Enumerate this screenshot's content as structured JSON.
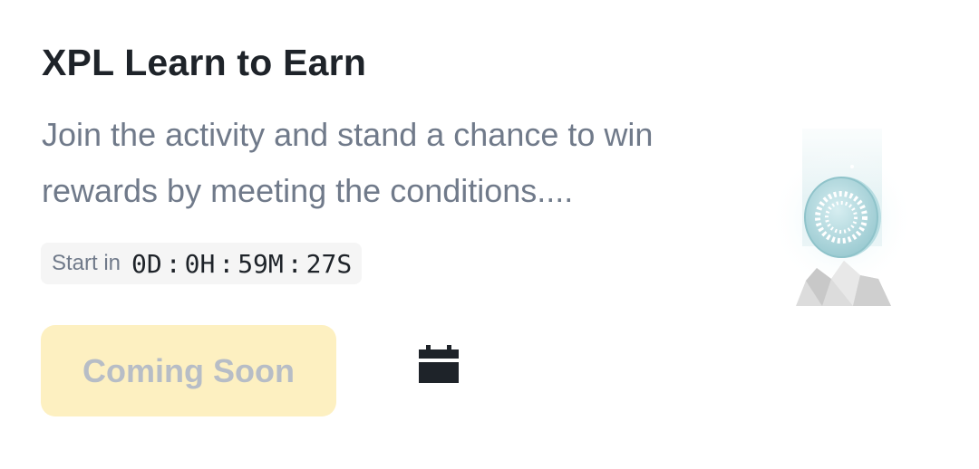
{
  "activity": {
    "title": "XPL Learn to Earn",
    "description": "Join the activity and stand a chance to win rewards by meeting the conditions....",
    "countdown": {
      "label": "Start in",
      "days": "0D",
      "hours": "0H",
      "minutes": "59M",
      "seconds": "27S",
      "separator": ":"
    },
    "button_label": "Coming Soon",
    "calendar_icon": "calendar-icon",
    "illustration_icon": "coin-illustration-icon"
  },
  "colors": {
    "title": "#1e2329",
    "description": "#707a8a",
    "countdown_bg": "#f5f5f5",
    "button_bg": "#fdf0c1",
    "button_text": "#b7bdc6",
    "coin": "#a9d6dc"
  }
}
